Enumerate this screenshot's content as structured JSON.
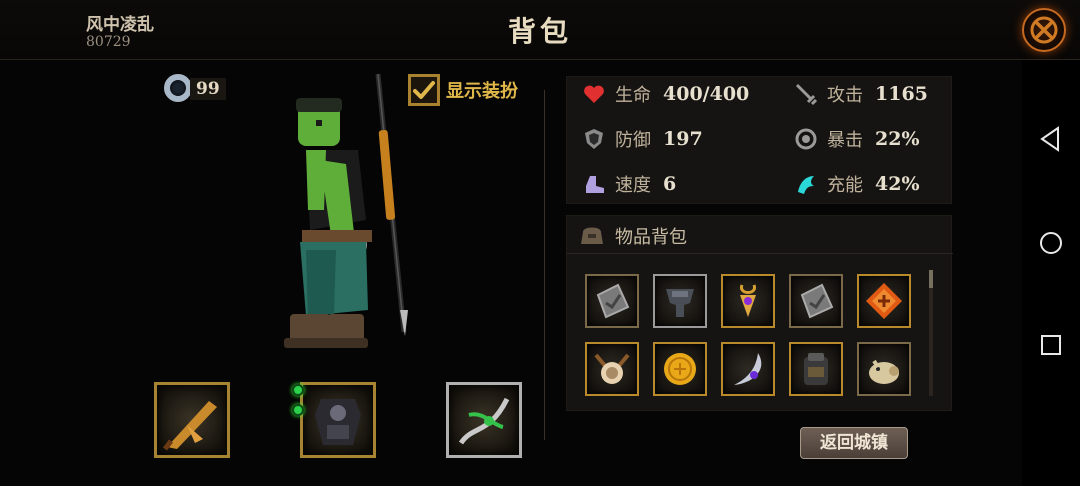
{
  "header": {
    "player_name": "风中凌乱",
    "player_id": "80729",
    "title": "背包"
  },
  "currency": {
    "amount": "99",
    "icon": "ring-icon"
  },
  "outfit_toggle": {
    "label": "显示装扮",
    "checked": true
  },
  "equipment": [
    {
      "icon": "weapon-blade-icon"
    },
    {
      "icon": "armor-icon",
      "gems": 2
    },
    {
      "icon": "accessory-vine-icon"
    }
  ],
  "stats": [
    {
      "icon": "heart-icon",
      "label": "生命",
      "value": "400/400",
      "color": "#e03030"
    },
    {
      "icon": "sword-icon",
      "label": "攻击",
      "value": "1165",
      "color": "#9a9a9a"
    },
    {
      "icon": "shield-icon",
      "label": "防御",
      "value": "197",
      "color": "#9a9a9a"
    },
    {
      "icon": "crit-icon",
      "label": "暴击",
      "value": "22%",
      "color": "#9a9a9a"
    },
    {
      "icon": "boot-icon",
      "label": "速度",
      "value": "6",
      "color": "#b0a0e0"
    },
    {
      "icon": "charge-icon",
      "label": "充能",
      "value": "42%",
      "color": "#2ad8d8"
    }
  ],
  "bag": {
    "title": "物品背包",
    "icon": "bag-icon",
    "items": [
      {
        "icon": "stone-tablet-icon"
      },
      {
        "icon": "helmet-icon"
      },
      {
        "icon": "amulet-icon"
      },
      {
        "icon": "stone-tablet-icon"
      },
      {
        "icon": "fire-rune-icon"
      },
      {
        "icon": "horn-mask-icon"
      },
      {
        "icon": "gold-coin-icon"
      },
      {
        "icon": "claw-blade-icon"
      },
      {
        "icon": "backpack-armor-icon"
      },
      {
        "icon": "pig-pet-icon"
      }
    ]
  },
  "return_button": {
    "label": "返回城镇"
  },
  "nav": {
    "back": "back-icon",
    "home": "home-icon",
    "recents": "recents-icon"
  }
}
